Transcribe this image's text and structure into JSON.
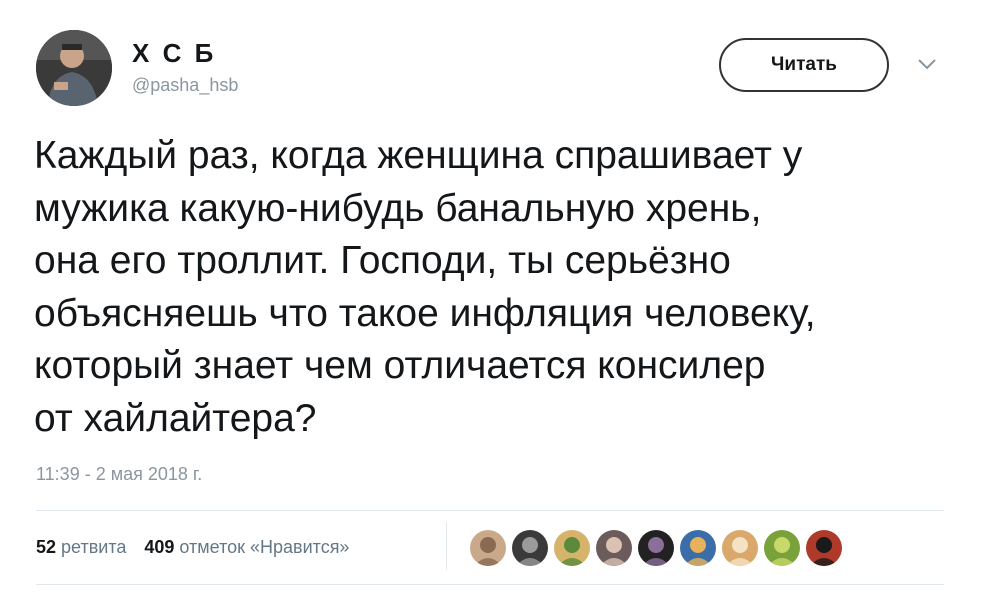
{
  "author": {
    "name": "Х С Б",
    "handle": "@pasha_hsb"
  },
  "follow_button_label": "Читать",
  "icons": {
    "avatar": "profile-photo",
    "menu": "chevron-down-icon"
  },
  "tweet_text": "Каждый раз, когда женщина спрашивает у\nмужика какую-нибудь банальную хрень,\nона его троллит. Господи, ты серьёзно\nобъясняешь что такое инфляция человеку,\nкоторый знает чем отличается консилер\nот хайлайтера?",
  "timestamp": "11:39 - 2 мая 2018 г.",
  "stats": {
    "retweets_count": "52",
    "retweets_label": "ретвита",
    "likes_count": "409",
    "likes_label": "отметок «Нравится»"
  },
  "liker_avatars": [
    {
      "colors": [
        "#c9a98a",
        "#8a6a52"
      ]
    },
    {
      "colors": [
        "#3a3a3a",
        "#9a9a9a"
      ]
    },
    {
      "colors": [
        "#d6b36a",
        "#5b8a3a"
      ]
    },
    {
      "colors": [
        "#6b5b5b",
        "#d9c2b2"
      ]
    },
    {
      "colors": [
        "#222222",
        "#8a6f9a"
      ]
    },
    {
      "colors": [
        "#3b6ea8",
        "#e8b25a"
      ]
    },
    {
      "colors": [
        "#d9a86a",
        "#f4e2c4"
      ]
    },
    {
      "colors": [
        "#7aa23a",
        "#c8d86a"
      ]
    },
    {
      "colors": [
        "#b03a2a",
        "#1a1a1a"
      ]
    }
  ],
  "colors": {
    "text": "#14171a",
    "secondary": "#8a96a0",
    "border": "#e1e8ed"
  }
}
